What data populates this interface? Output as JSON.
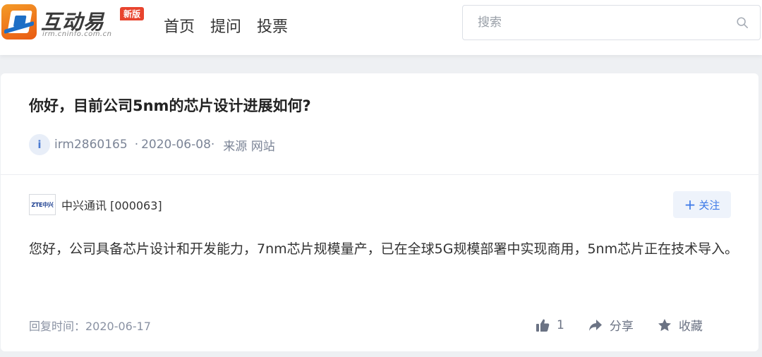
{
  "header": {
    "logo_title": "互动易",
    "logo_sub": "irm.cninfo.com.cn",
    "logo_badge": "新版",
    "nav": [
      "首页",
      "提问",
      "投票"
    ],
    "search_placeholder": "搜索",
    "search_icon": "search-icon"
  },
  "question": {
    "title": "你好，目前公司5nm的芯片设计进展如何?",
    "avatar_letter": "i",
    "user": "irm2860165",
    "date_sep_prefix": "·",
    "date": "2020-06-08·",
    "source": "来源 网站"
  },
  "answer": {
    "company_logo_text": "ZTE中兴",
    "company": "中兴通讯 [000063]",
    "follow_plus": "+",
    "follow_label": "关注",
    "text": "您好，公司具备芯片设计和开发能力，7nm芯片规模量产，已在全球5G规模部署中实现商用，5nm芯片正在技术导入。",
    "reply_time": "回复时间：2020-06-17",
    "like_count": "1",
    "share_label": "分享",
    "favorite_label": "收藏"
  },
  "colors": {
    "accent": "#3b78e7",
    "logo_orange": "#e95a12",
    "badge_red": "#e8442e"
  }
}
